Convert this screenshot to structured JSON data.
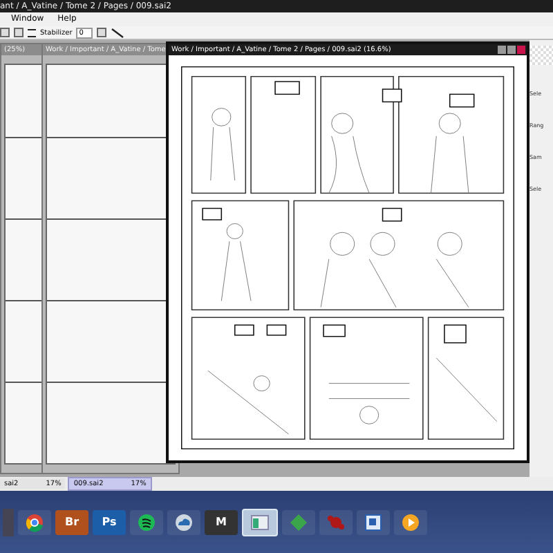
{
  "app_title": "ant / A_Vatine / Tome 2 / Pages / 009.sai2",
  "menu": [
    "Window",
    "Help"
  ],
  "toolbar": {
    "stabilizer_label": "Stabilizer",
    "stabilizer_value": "0"
  },
  "windows": [
    {
      "title": "(25%)",
      "active": false
    },
    {
      "title": "Work / Important / A_Vatine / Tome",
      "active": false
    },
    {
      "title": "Work / Important / A_Vatine / Tome 2 / Pages / 009.sai2 (16.6%)",
      "active": true
    }
  ],
  "panel_labels": [
    "Sele",
    "Rang",
    "Sam",
    "Sele"
  ],
  "file_tabs": [
    {
      "name": "sai2",
      "zoom": "17%",
      "selected": false
    },
    {
      "name": "009.sai2",
      "zoom": "17%",
      "selected": true
    }
  ],
  "taskbar": [
    {
      "kind": "chrome",
      "active": false
    },
    {
      "kind": "badge",
      "label": "Br",
      "color": "#b0501c",
      "active": false
    },
    {
      "kind": "badge",
      "label": "Ps",
      "color": "#1c5fa8",
      "active": false
    },
    {
      "kind": "spotify",
      "active": false
    },
    {
      "kind": "cloud",
      "active": false
    },
    {
      "kind": "badge",
      "label": "M",
      "color": "#333333",
      "active": false
    },
    {
      "kind": "window",
      "active": true
    },
    {
      "kind": "diamond",
      "active": false
    },
    {
      "kind": "splat",
      "active": false
    },
    {
      "kind": "frame",
      "active": false
    },
    {
      "kind": "play",
      "active": false
    }
  ]
}
